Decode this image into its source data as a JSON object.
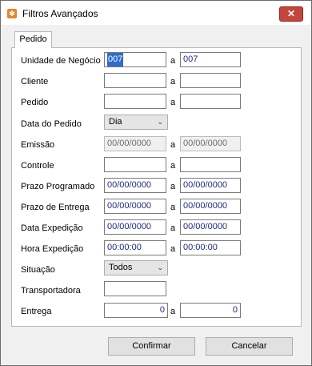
{
  "window": {
    "title": "Filtros Avançados",
    "close_glyph": "✕"
  },
  "tab": {
    "label": "Pedido"
  },
  "sep": "a",
  "fields": {
    "unidade": {
      "label": "Unidade de Negócio",
      "from": "007",
      "to": "007"
    },
    "cliente": {
      "label": "Cliente",
      "from": "",
      "to": ""
    },
    "pedido": {
      "label": "Pedido",
      "from": "",
      "to": ""
    },
    "data_pedido": {
      "label": "Data do Pedido",
      "value": "Dia"
    },
    "emissao": {
      "label": "Emissão",
      "from": "00/00/0000",
      "to": "00/00/0000"
    },
    "controle": {
      "label": "Controle",
      "from": "",
      "to": ""
    },
    "prazo_programado": {
      "label": "Prazo Programado",
      "from": "00/00/0000",
      "to": "00/00/0000"
    },
    "prazo_entrega": {
      "label": "Prazo de Entrega",
      "from": "00/00/0000",
      "to": "00/00/0000"
    },
    "data_expedicao": {
      "label": "Data Expedição",
      "from": "00/00/0000",
      "to": "00/00/0000"
    },
    "hora_expedicao": {
      "label": "Hora Expedição",
      "from": "00:00:00",
      "to": "00:00:00"
    },
    "situacao": {
      "label": "Situação",
      "value": "Todos"
    },
    "transportadora": {
      "label": "Transportadora",
      "value": ""
    },
    "entrega": {
      "label": "Entrega",
      "from": "0",
      "to": "0"
    }
  },
  "buttons": {
    "confirm": "Confirmar",
    "cancel": "Cancelar"
  }
}
